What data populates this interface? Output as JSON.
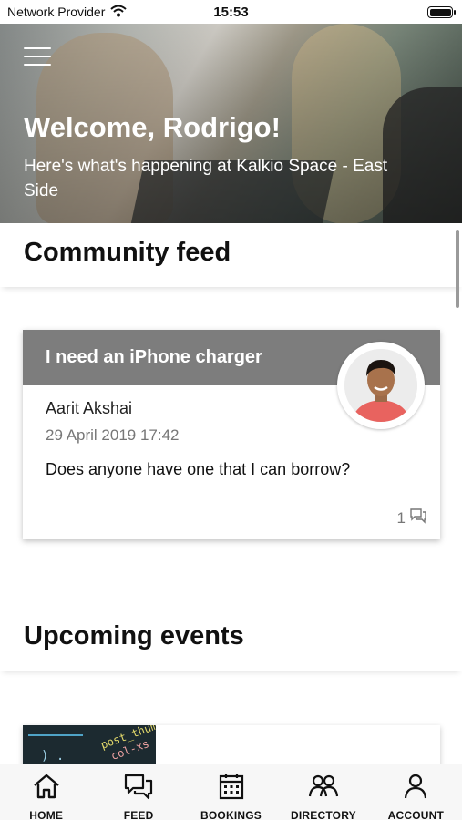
{
  "status_bar": {
    "carrier": "Network Provider",
    "time": "15:53"
  },
  "hero": {
    "title": "Welcome, Rodrigo!",
    "subtitle": "Here's what's happening at Kalkio Space - East Side"
  },
  "community_feed": {
    "heading": "Community feed",
    "posts": [
      {
        "title": "I need an iPhone charger",
        "author": "Aarit Akshai",
        "date": "29 April 2019 17:42",
        "body": "Does anyone have one that I can borrow?",
        "comment_count": "1"
      }
    ]
  },
  "upcoming_events": {
    "heading": "Upcoming events",
    "thumbnail_code": [
      "post_thum",
      "col-xs",
      ") ."
    ]
  },
  "tabbar": {
    "items": [
      {
        "label": "HOME",
        "icon": "home-icon"
      },
      {
        "label": "FEED",
        "icon": "chat-icon"
      },
      {
        "label": "BOOKINGS",
        "icon": "calendar-icon"
      },
      {
        "label": "DIRECTORY",
        "icon": "people-icon"
      },
      {
        "label": "ACCOUNT",
        "icon": "person-icon"
      }
    ]
  },
  "colors": {
    "card_header": "#7d7d7d",
    "hero_text": "#ffffff",
    "tabbar_bg": "#f7f7f7"
  }
}
